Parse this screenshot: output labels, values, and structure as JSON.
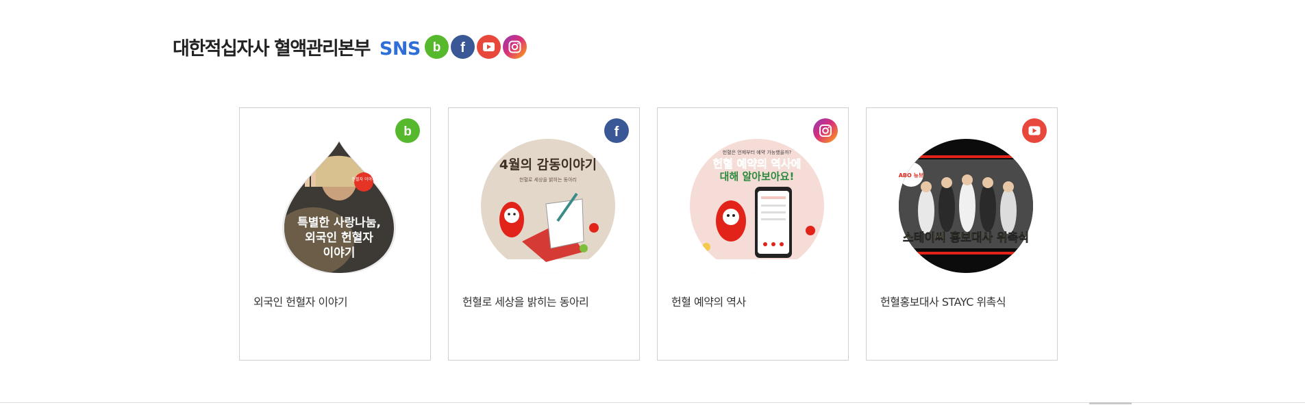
{
  "header": {
    "title": "대한적십자사 혈액관리본부",
    "sns_label": "SNS",
    "icons": [
      "blog-icon",
      "facebook-icon",
      "youtube-icon",
      "instagram-icon"
    ]
  },
  "colors": {
    "accent_blue": "#2f6fd8",
    "blog_green": "#56b92d",
    "facebook_blue": "#3a5896",
    "youtube_red": "#e8483b"
  },
  "cards": [
    {
      "platform": "blog",
      "caption": "외국인 헌혈자 이야기",
      "image_text": [
        "특별한 사랑나눔,",
        "외국인 헌혈자",
        "이야기"
      ],
      "sticker": "헌혈자 이야기"
    },
    {
      "platform": "facebook",
      "caption": "헌혈로 세상을 밝히는 동아리",
      "image_text": [
        "4월의 감동이야기",
        "헌혈로 세상을 밝히는 동아리"
      ]
    },
    {
      "platform": "instagram",
      "caption": "헌혈 예약의 역사",
      "image_text": [
        "헌혈은 언제부터 예약 가능했을까?",
        "헌혈 예약의 역사에",
        "대해 알아보아요!"
      ]
    },
    {
      "platform": "youtube",
      "caption": "헌혈홍보대사 STAYC 위촉식",
      "image_text": [
        "스테이씨 홍보대사 위촉식",
        "ABO 뉴브"
      ]
    }
  ]
}
